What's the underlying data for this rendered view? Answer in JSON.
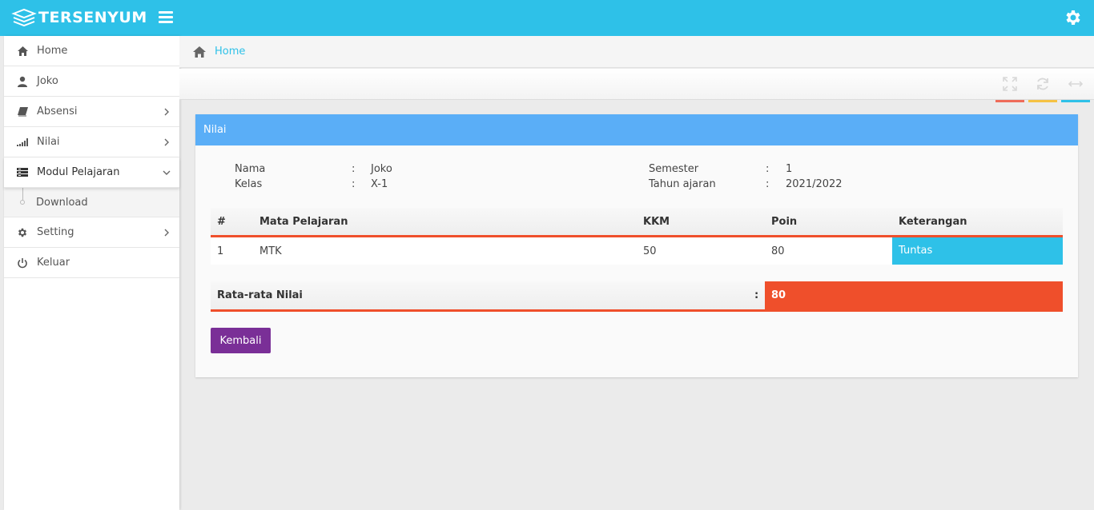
{
  "app": {
    "brand": "TERSENYUM",
    "logo_icon": "books-stack-icon",
    "accent_color": "#2ec1e8"
  },
  "sidebar": {
    "items": [
      {
        "label": "Home",
        "icon": "home-icon"
      },
      {
        "label": "Joko",
        "icon": "user-icon"
      },
      {
        "label": "Absensi",
        "icon": "book-icon",
        "has_submenu": true
      },
      {
        "label": "Nilai",
        "icon": "signal-bars-icon",
        "has_submenu": true
      },
      {
        "label": "Modul Pelajaran",
        "icon": "list-icon",
        "has_submenu": true,
        "expanded": true
      },
      {
        "label": "Download",
        "sub": true
      },
      {
        "label": "Setting",
        "icon": "gear-icon",
        "has_submenu": true
      },
      {
        "label": "Keluar",
        "icon": "power-icon"
      }
    ]
  },
  "breadcrumb": {
    "home_label": "Home"
  },
  "toolbar": {
    "buttons": [
      {
        "icon": "expand-icon",
        "color": "#ef6c5a"
      },
      {
        "icon": "refresh-icon",
        "color": "#f5c243"
      },
      {
        "icon": "resize-horizontal-icon",
        "color": "#2ec1e8"
      }
    ]
  },
  "panel": {
    "title": "Nilai",
    "info": {
      "nama_label": "Nama",
      "nama_value": "Joko",
      "kelas_label": "Kelas",
      "kelas_value": "X-1",
      "semester_label": "Semester",
      "semester_value": "1",
      "tahun_label": "Tahun ajaran",
      "tahun_value": "2021/2022",
      "separator": ":"
    },
    "table": {
      "headers": [
        "#",
        "Mata Pelajaran",
        "KKM",
        "Poin",
        "Keterangan"
      ],
      "rows": [
        {
          "no": "1",
          "mapel": "MTK",
          "kkm": "50",
          "poin": "80",
          "keterangan": "Tuntas"
        }
      ]
    },
    "average": {
      "label": "Rata-rata Nilai",
      "separator": ":",
      "value": "80"
    },
    "back_button": "Kembali"
  }
}
